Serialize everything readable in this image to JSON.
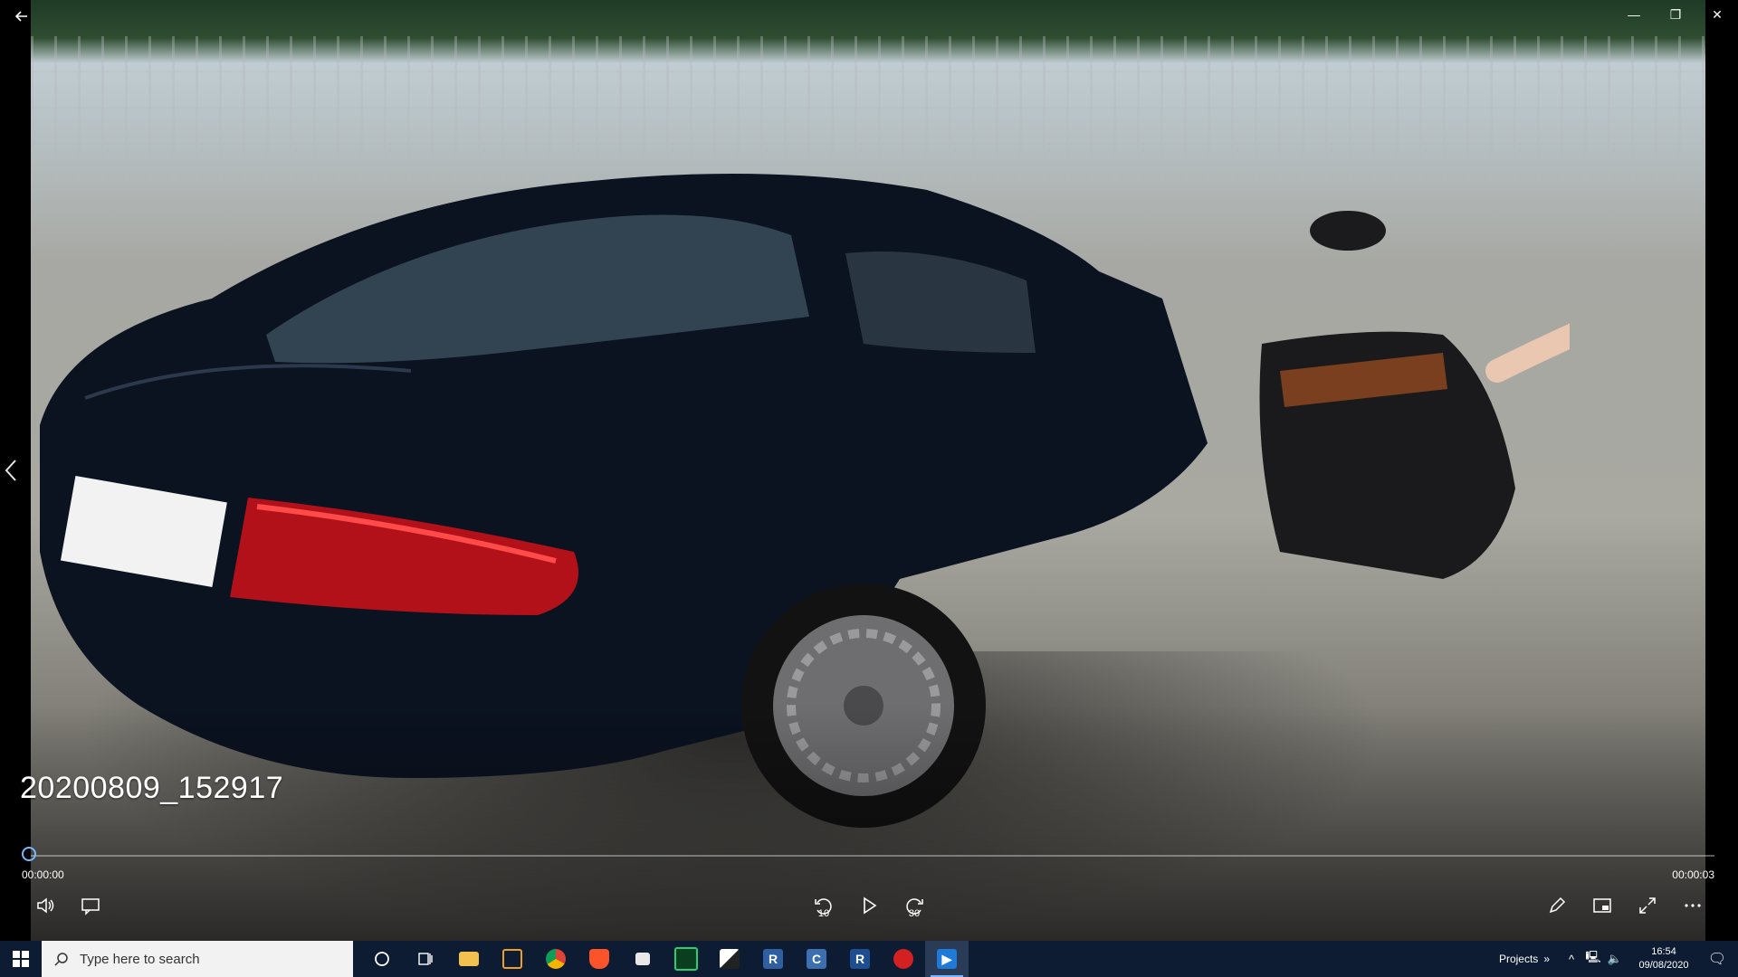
{
  "window": {
    "back_icon": "back-arrow-icon",
    "controls": [
      "minimize",
      "restore",
      "close"
    ],
    "control_glyphs": {
      "minimize": "—",
      "restore": "❐",
      "close": "✕"
    }
  },
  "video": {
    "title": "20200809_152917",
    "time_current": "00:00:00",
    "time_total": "00:00:03",
    "progress": 0.0
  },
  "controls": {
    "skip_back_label": "10",
    "skip_forward_label": "30"
  },
  "taskbar": {
    "search_placeholder": "Type here to search",
    "apps": [
      "cortana",
      "task-view",
      "file-explorer",
      "mail",
      "chrome",
      "brave",
      "files",
      "app-green",
      "app-puzzle",
      "app-r",
      "app-c",
      "app-r-blue",
      "app-red",
      "movies-tv"
    ],
    "tray_label": "Projects",
    "time": "16:54",
    "date": "09/08/2020"
  },
  "colors": {
    "taskbar_bg": "#0e1c33",
    "accent": "#78b5ff",
    "progress_thumb": "#7ab8ff"
  }
}
